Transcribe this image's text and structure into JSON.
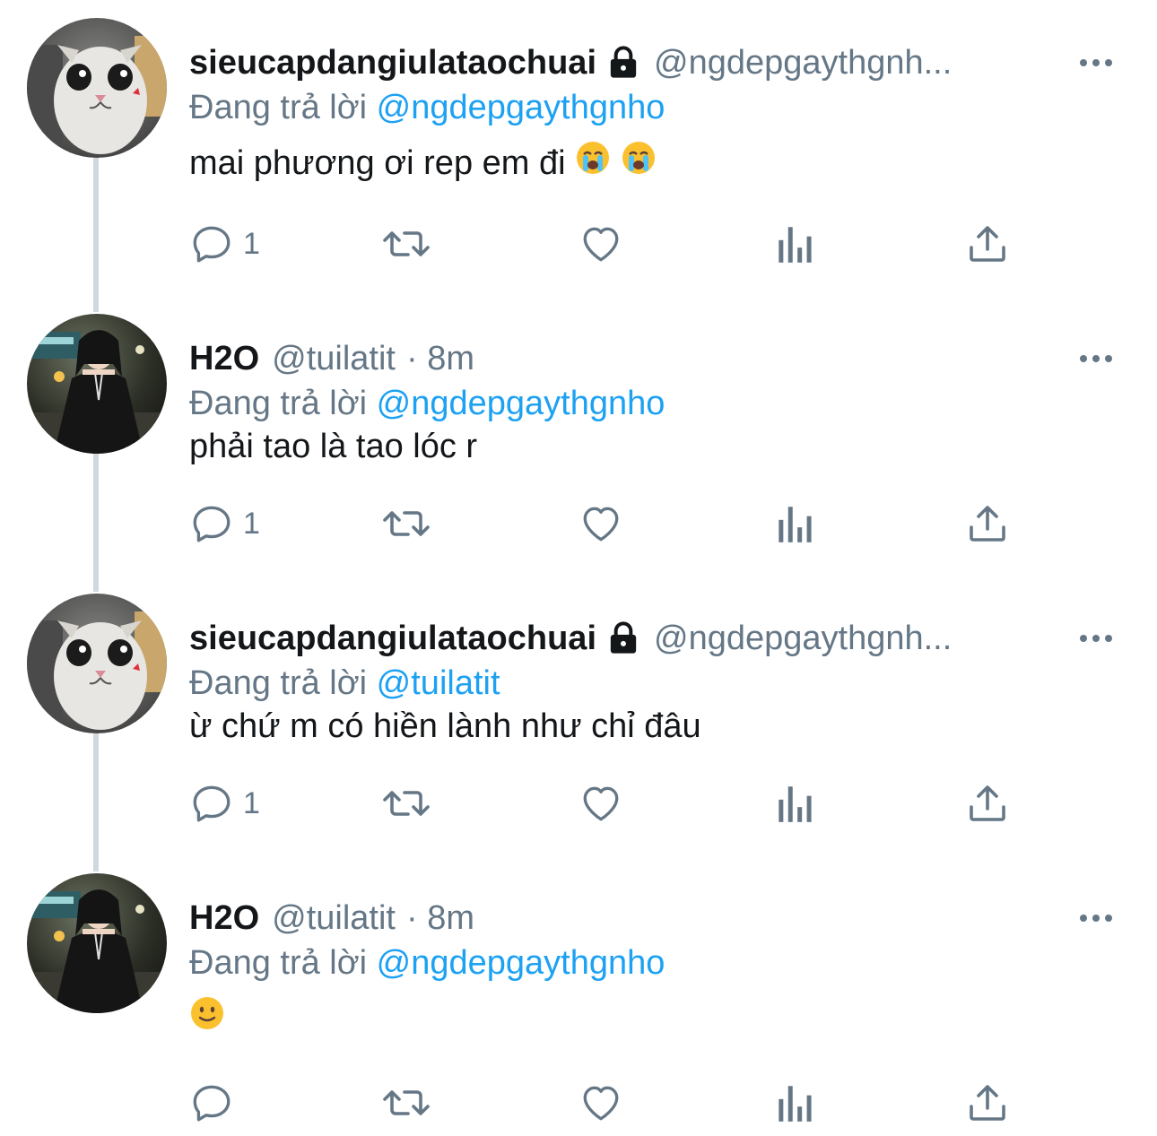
{
  "colors": {
    "name": "#14171a",
    "secondary": "#657786",
    "mention": "#1da1f2",
    "thread_line": "#cfd9de"
  },
  "replying_label": "Đang trả lời",
  "tweets": [
    {
      "name": "sieucapdangiulataochuai",
      "handle": "@ngdepgaythgnh...",
      "protected": true,
      "time": "",
      "reply_to": "@ngdepgaythgnho",
      "text": "mai phương ơi rep em đi",
      "emojis": [
        "loudly-crying-face",
        "loudly-crying-face"
      ],
      "reply_count": "1",
      "avatar": "cat-avatar"
    },
    {
      "name": "H2O",
      "handle": "@tuilatit",
      "protected": false,
      "time": "· 8m",
      "reply_to": "@ngdepgaythgnho",
      "text": "phải tao là tao lóc r",
      "emojis": [],
      "reply_count": "1",
      "avatar": "girl-avatar"
    },
    {
      "name": "sieucapdangiulataochuai",
      "handle": "@ngdepgaythgnh...",
      "protected": true,
      "time": "",
      "reply_to": "@tuilatit",
      "text": "ừ chứ m có hiền lành như chỉ đâu",
      "emojis": [],
      "reply_count": "1",
      "avatar": "cat-avatar"
    },
    {
      "name": "H2O",
      "handle": "@tuilatit",
      "protected": false,
      "time": "· 8m",
      "reply_to": "@ngdepgaythgnho",
      "text": "",
      "emojis": [
        "slightly-smiling-face"
      ],
      "reply_count": "",
      "avatar": "girl-avatar"
    }
  ],
  "action_icons": [
    "reply-icon",
    "retweet-icon",
    "like-icon",
    "views-icon",
    "share-icon"
  ]
}
